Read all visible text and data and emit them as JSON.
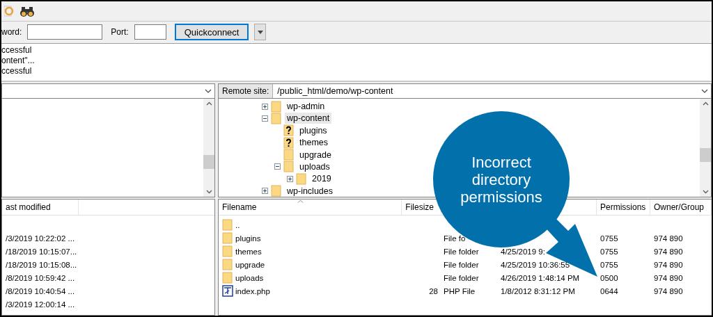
{
  "quickconnect": {
    "password_label": "word:",
    "port_label": "Port:",
    "button": "Quickconnect"
  },
  "log": [
    "ccessful",
    "ontent\"...",
    "ccessful"
  ],
  "remote_site": {
    "label": "Remote site:",
    "path": "/public_html/demo/wp-content"
  },
  "remote_tree": [
    {
      "name": "wp-admin",
      "kind": "folder",
      "expandable": true,
      "expanded": false,
      "selected": false
    },
    {
      "name": "wp-content",
      "kind": "folder",
      "expandable": true,
      "expanded": true,
      "selected": true,
      "children": [
        {
          "name": "plugins",
          "kind": "unknown",
          "expandable": false,
          "selected": false
        },
        {
          "name": "themes",
          "kind": "unknown",
          "expandable": false,
          "selected": false
        },
        {
          "name": "upgrade",
          "kind": "folder",
          "expandable": false,
          "selected": false
        },
        {
          "name": "uploads",
          "kind": "folder",
          "expandable": true,
          "expanded": true,
          "selected": false,
          "children": [
            {
              "name": "2019",
              "kind": "folder",
              "expandable": true,
              "expanded": false,
              "selected": false
            }
          ]
        }
      ]
    },
    {
      "name": "wp-includes",
      "kind": "folder",
      "expandable": true,
      "expanded": false,
      "selected": false
    }
  ],
  "local_list": {
    "header": "ast modified",
    "rows": [
      "/3/2019 10:22:02 ...",
      "/18/2019 10:15:07...",
      "/18/2019 10:15:08...",
      "/8/2019 10:59:42 ...",
      "/8/2019 10:40:54 ...",
      "/3/2019 12:00:14 ..."
    ]
  },
  "remote_list": {
    "columns": [
      "Filename",
      "Filesize",
      "Permissions",
      "Owner/Group"
    ],
    "rows": [
      {
        "kind": "folder",
        "name": ".."
      },
      {
        "kind": "folder",
        "name": "plugins",
        "type": "File fo",
        "permissions": "0755",
        "owner": "974 890"
      },
      {
        "kind": "folder",
        "name": "themes",
        "type": "File folder",
        "modified": "4/25/2019 9:",
        "permissions": "0755",
        "owner": "974 890"
      },
      {
        "kind": "folder",
        "name": "upgrade",
        "type": "File folder",
        "modified": "4/25/2019 10:36:55",
        "permissions": "0755",
        "owner": "974 890"
      },
      {
        "kind": "folder",
        "name": "uploads",
        "type": "File folder",
        "modified": "4/26/2019 1:48:14 PM",
        "permissions": "0500",
        "owner": "974 890"
      },
      {
        "kind": "php",
        "name": "index.php",
        "size": "28",
        "type": "PHP File",
        "modified": "1/8/2012 8:31:12 PM",
        "permissions": "0644",
        "owner": "974 890"
      }
    ]
  },
  "callout": {
    "text": "Incorrect directory permissions"
  }
}
